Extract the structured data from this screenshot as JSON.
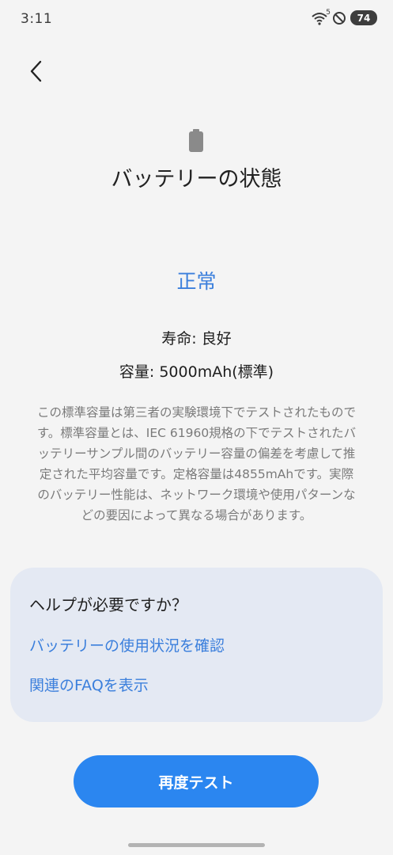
{
  "status_bar": {
    "time": "3:11",
    "battery_level": "74",
    "wifi_label": "5"
  },
  "header": {
    "back_icon": "chevron-left-icon",
    "battery_icon": "battery-icon",
    "title": "バッテリーの状態"
  },
  "battery": {
    "status": "正常",
    "life": "寿命: 良好",
    "capacity": "容量: 5000mAh(標準)",
    "description": "この標準容量は第三者の実験環境下でテストされたものです。標準容量とは、IEC 61960規格の下でテストされたバッテリーサンプル間のバッテリー容量の偏差を考慮して推定された平均容量です。定格容量は4855mAhです。実際のバッテリー性能は、ネットワーク環境や使用パターンなどの要因によって異なる場合があります。"
  },
  "help": {
    "title": "ヘルプが必要ですか？",
    "links": [
      "バッテリーの使用状況を確認",
      "関連のFAQを表示"
    ]
  },
  "actions": {
    "retest_label": "再度テスト"
  },
  "colors": {
    "accent": "#3b7fdc",
    "button": "#2b86f0",
    "card": "#e4e9f3",
    "background": "#f4f4f4"
  }
}
